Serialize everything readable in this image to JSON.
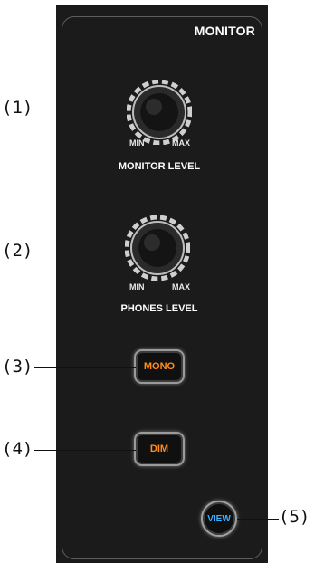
{
  "section": {
    "title": "MONITOR"
  },
  "knobs": [
    {
      "callout": "(1)",
      "min": "MIN",
      "max": "MAX",
      "label": "MONITOR LEVEL"
    },
    {
      "callout": "(2)",
      "min": "MIN",
      "max": "MAX",
      "label": "PHONES LEVEL"
    }
  ],
  "buttons": [
    {
      "callout": "(3)",
      "label": "MONO",
      "text_color": "#ff8c1a"
    },
    {
      "callout": "(4)",
      "label": "DIM",
      "text_color": "#ff8c1a"
    },
    {
      "callout": "(5)",
      "label": "VIEW",
      "text_color": "#3ab0ff"
    }
  ],
  "colors": {
    "panel": "#1b1b1b",
    "panel_border": "#5e5e5e",
    "text": "#ffffff"
  }
}
